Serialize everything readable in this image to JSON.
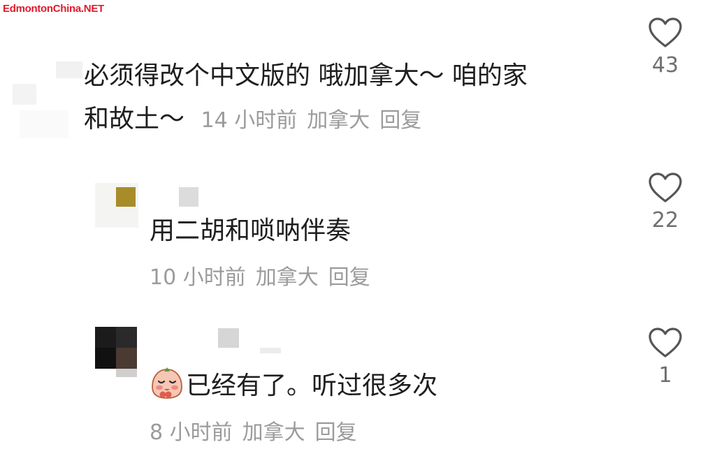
{
  "watermark": "EdmontonChina.NET",
  "comments": [
    {
      "text_line1": "必须得改个中文版的 哦加拿大～ 咱的家",
      "text_line2": "和故土～",
      "time": "14 小时前",
      "location": "加拿大",
      "reply_label": "回复",
      "likes": "43"
    },
    {
      "text": "用二胡和唢呐伴奏",
      "time": "10 小时前",
      "location": "加拿大",
      "reply_label": "回复",
      "likes": "22"
    },
    {
      "text": "已经有了。听过很多次",
      "emoji": "blushing-face-emoji",
      "time": "8 小时前",
      "location": "加拿大",
      "reply_label": "回复",
      "likes": "1"
    }
  ],
  "icons": {
    "like": "heart-outline-icon"
  },
  "colors": {
    "text": "#1e1e1e",
    "meta": "#9b9b9b",
    "like_count": "#6f6f6f",
    "watermark": "#e01a2b"
  }
}
